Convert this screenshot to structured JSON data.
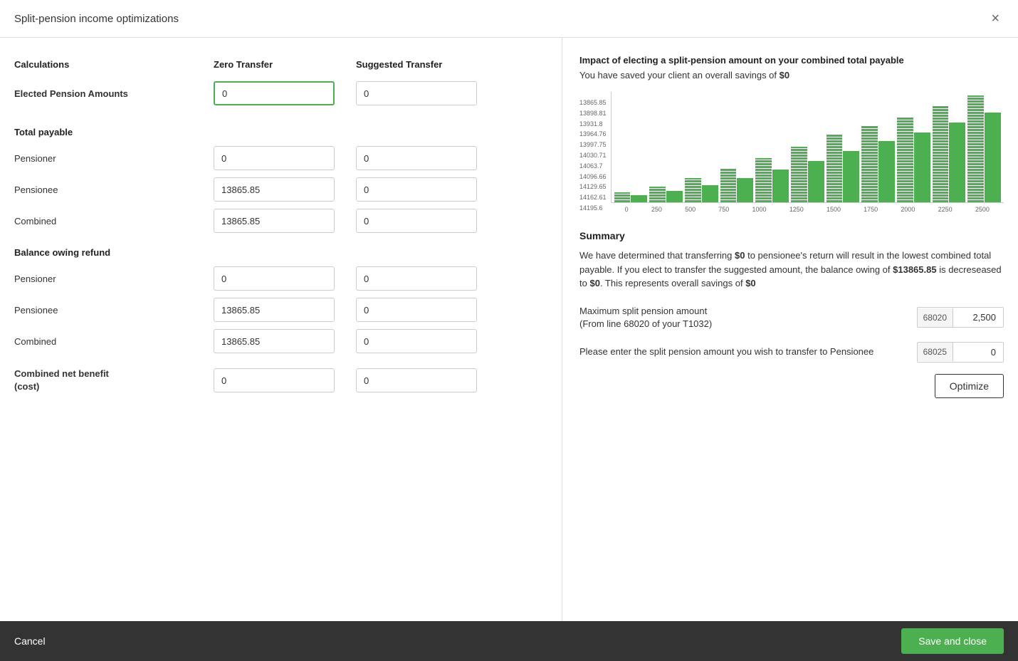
{
  "header": {
    "title": "Split-pension income optimizations",
    "close_label": "×"
  },
  "columns": {
    "calculations": "Calculations",
    "zero_transfer": "Zero Transfer",
    "suggested_transfer": "Suggested Transfer"
  },
  "elected_pension": {
    "label": "Elected Pension Amounts",
    "zero_value": "0",
    "suggested_value": "0"
  },
  "total_payable": {
    "title": "Total payable",
    "rows": [
      {
        "label": "Pensioner",
        "zero": "0",
        "suggested": "0"
      },
      {
        "label": "Pensionee",
        "zero": "13865.85",
        "suggested": "0"
      },
      {
        "label": "Combined",
        "zero": "13865.85",
        "suggested": "0"
      }
    ]
  },
  "balance_owing": {
    "title": "Balance owing refund",
    "rows": [
      {
        "label": "Pensioner",
        "zero": "0",
        "suggested": "0"
      },
      {
        "label": "Pensionee",
        "zero": "13865.85",
        "suggested": "0"
      },
      {
        "label": "Combined",
        "zero": "13865.85",
        "suggested": "0"
      }
    ]
  },
  "combined_net": {
    "label": "Combined net benefit\n(cost)",
    "zero": "0",
    "suggested": "0"
  },
  "right_panel": {
    "impact_title": "Impact of electing a split-pension amount on your combined total payable",
    "savings_text": "You have saved your client an overall savings of ",
    "savings_amount": "$0",
    "chart": {
      "y_labels": [
        "14195.6",
        "14162.61",
        "14129.65",
        "14096.66",
        "14063.7",
        "14030.71",
        "13997.75",
        "13964.76",
        "13931.8",
        "13898.81",
        "13865.85"
      ],
      "x_labels": [
        "0",
        "250",
        "500",
        "750",
        "1000",
        "1250",
        "1500",
        "1750",
        "2000",
        "2250",
        "2500"
      ],
      "bars": [
        12,
        18,
        28,
        38,
        55,
        70,
        85,
        95,
        110,
        125,
        145,
        155
      ]
    },
    "summary_title": "Summary",
    "summary_text_1": "We have determined that transferring ",
    "summary_bold_1": "$0",
    "summary_text_2": " to pensionee's return will result in the lowest combined total payable. If you elect to transfer the suggested amount, the balance owing of ",
    "summary_bold_2": "$13865.85",
    "summary_text_3": " is decreseased to ",
    "summary_bold_3": "$0",
    "summary_text_4": ". This represents overall savings of ",
    "summary_bold_4": "$0",
    "max_split": {
      "label": "Maximum split pension amount\n(From line 68020 of your T1032)",
      "prefix": "68020",
      "value": "2,500"
    },
    "enter_split": {
      "label": "Please enter the split pension amount you wish to transfer to Pensionee",
      "prefix": "68025",
      "value": "0"
    },
    "optimize_label": "Optimize"
  },
  "footer": {
    "cancel_label": "Cancel",
    "save_close_label": "Save and close"
  }
}
